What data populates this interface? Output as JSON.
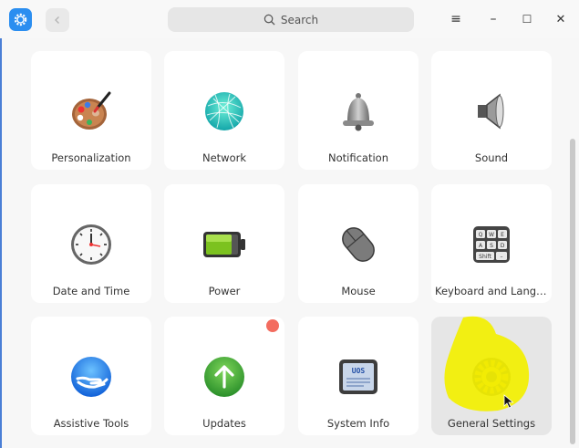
{
  "search": {
    "label": "Search"
  },
  "window_controls": {
    "menu": "≡",
    "minimize": "–",
    "maximize": "☐",
    "close": "✕"
  },
  "colors": {
    "accent": "#2b8ef0",
    "badge": "#f36c5f",
    "highlight": "#f3f000"
  },
  "cards": [
    {
      "label": "Personalization",
      "icon": "palette-icon"
    },
    {
      "label": "Network",
      "icon": "network-globe-icon"
    },
    {
      "label": "Notification",
      "icon": "bell-icon"
    },
    {
      "label": "Sound",
      "icon": "speaker-icon"
    },
    {
      "label": "Date and Time",
      "icon": "clock-icon"
    },
    {
      "label": "Power",
      "icon": "battery-icon"
    },
    {
      "label": "Mouse",
      "icon": "mouse-icon"
    },
    {
      "label": "Keyboard and Langua...",
      "icon": "keyboard-icon"
    },
    {
      "label": "Assistive Tools",
      "icon": "assistive-hand-icon"
    },
    {
      "label": "Updates",
      "icon": "update-arrow-icon"
    },
    {
      "label": "System Info",
      "icon": "system-info-icon"
    },
    {
      "label": "General Settings",
      "icon": "gear-icon"
    }
  ]
}
